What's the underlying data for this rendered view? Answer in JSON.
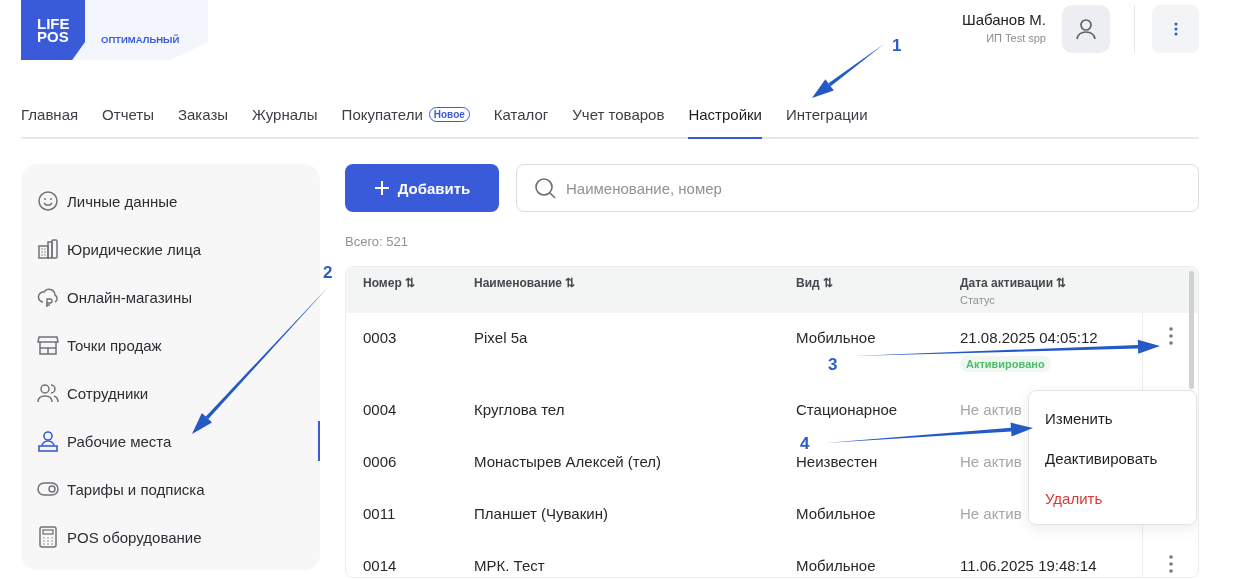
{
  "logo": {
    "line_1": "LIFE",
    "line_2": "POS",
    "plan": "ОПТИМАЛЬНЫЙ"
  },
  "user": {
    "name": "Шабанов М.",
    "company": "ИП Test spp"
  },
  "tabs": [
    {
      "label": "Главная",
      "selected": false
    },
    {
      "label": "Отчеты",
      "selected": false
    },
    {
      "label": "Заказы",
      "selected": false
    },
    {
      "label": "Журналы",
      "selected": false
    },
    {
      "label": "Покупатели",
      "selected": false,
      "badge": "Новое"
    },
    {
      "label": "Каталог",
      "selected": false
    },
    {
      "label": "Учет товаров",
      "selected": false
    },
    {
      "label": "Настройки",
      "selected": true
    },
    {
      "label": "Интеграции",
      "selected": false
    }
  ],
  "sidebar": {
    "items": [
      {
        "label": "Личные данные",
        "selected": false
      },
      {
        "label": "Юридические лица",
        "selected": false
      },
      {
        "label": "Онлайн-магазины",
        "selected": false
      },
      {
        "label": "Точки продаж",
        "selected": false
      },
      {
        "label": "Сотрудники",
        "selected": false
      },
      {
        "label": "Рабочие места",
        "selected": true
      },
      {
        "label": "Тарифы и подписка",
        "selected": false
      },
      {
        "label": "POS оборудование",
        "selected": false
      }
    ]
  },
  "add_button": {
    "label": "Добавить"
  },
  "search": {
    "placeholder": "Наименование, номер"
  },
  "total": "Всего: 521",
  "table": {
    "columns": [
      {
        "label": "Номер",
        "sort": "⇅"
      },
      {
        "label": "Наименование",
        "sort": "⇅"
      },
      {
        "label": "Вид",
        "sort": "⇅"
      },
      {
        "label": "Дата активации",
        "sort": "⇅",
        "sub": "Статус"
      }
    ],
    "rows": [
      {
        "number": "0003",
        "name": "Pixel 5a",
        "type": "Мобильное",
        "date": "21.08.2025 04:05:12",
        "status": {
          "text": "Активировано",
          "kind": "badge"
        }
      },
      {
        "number": "0004",
        "name": "Круглова тел",
        "type": "Стационарное",
        "status": {
          "text": "Не актив",
          "kind": "plain"
        }
      },
      {
        "number": "0006",
        "name": "Монастырев Алексей (тел)",
        "type": "Неизвестен",
        "status": {
          "text": "Не актив",
          "kind": "plain"
        }
      },
      {
        "number": "0011",
        "name": "Планшет (Чувакин)",
        "type": "Мобильное",
        "status": {
          "text": "Не актив",
          "kind": "plain"
        }
      },
      {
        "number": "0014",
        "name": "МРК. Тест",
        "type": "Мобильное",
        "date": "11.06.2025 19:48:14"
      }
    ]
  },
  "context_menu": {
    "items": [
      {
        "label": "Изменить",
        "kind": "normal"
      },
      {
        "label": "Деактивировать",
        "kind": "normal"
      },
      {
        "label": "Удалить",
        "kind": "danger"
      }
    ]
  },
  "annotations": [
    {
      "label": "1"
    },
    {
      "label": "2"
    },
    {
      "label": "3"
    },
    {
      "label": "4"
    }
  ]
}
